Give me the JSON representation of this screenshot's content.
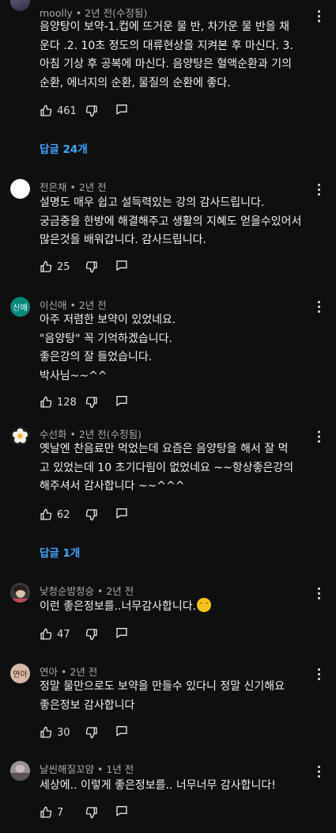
{
  "comments": [
    {
      "author": "moolly",
      "time": "2년 전(수정됨)",
      "lines": [
        "음양탕이 보약-1.컵에 뜨거운 물 반, 차가운 물 반을 채",
        "운다 .2. 10초 정도의 대류현상을 지켜본 후 마신다. 3.",
        "아침 기상 후 공복에 마신다. 음양탕은 혈액순환과 기의",
        "순환, 에너지의 순환, 물질의 순환에 좋다."
      ],
      "likes": "461",
      "replies": "답글 24개",
      "avatar_text": ""
    },
    {
      "author": "전은채",
      "time": "2년 전",
      "lines": [
        "설명도 매우 쉽고 설득력있는 강의 감사드립니다.",
        "궁금중을 한방에 해결해주고 생활의 지혜도 얻을수있어서",
        "많은것을 배워갑니다. 감사드립니다."
      ],
      "likes": "25",
      "avatar_text": ""
    },
    {
      "author": "이신애",
      "time": "2년 전",
      "lines": [
        "아주 저렴한 보약이 있었네요.",
        "\"음양탕\" 꼭 기억하겠습니다.",
        "좋은강의 잘 들었습니다.",
        "박사님~~^^"
      ],
      "likes": "128",
      "avatar_text": "신애"
    },
    {
      "author": "수선화",
      "time": "2년 전(수정됨)",
      "lines": [
        "옛날엔 찬음료만 먹었는데 요즘은 음양탕을 해서  잘 먹",
        "고 있었는데 10 초기다림이 없었네요 ~~항상좋은강의",
        "해주셔서 감사합니다 ~~^^^"
      ],
      "likes": "62",
      "replies": "답글 1개",
      "avatar_text": ""
    },
    {
      "author": "낮청순밤청승",
      "time": "2년 전",
      "lines": [
        "이런 좋은정보를..너무감사합니다."
      ],
      "likes": "47",
      "avatar_text": ""
    },
    {
      "author": "연아",
      "time": "2년 전",
      "lines": [
        "정말 물만으로도 보약을 만들수 있다니 정말 신기해요",
        "좋은정보 감사합니다"
      ],
      "likes": "30",
      "avatar_text": "연아"
    },
    {
      "author": "날씬해질꼬얌",
      "time": "1년 전",
      "lines": [
        "세상에.. 이렇게 좋은정보를.. 너무너무 감사합니다!"
      ],
      "likes": "7",
      "avatar_text": ""
    }
  ],
  "meta_separator": " • ",
  "colors": {
    "background": "#0f0f0f",
    "text": "#f1f1f1",
    "meta": "#aaaaaa",
    "link": "#3ea6ff",
    "avatar_sinae": "#00897b",
    "avatar_yeona": "#d7b9a6"
  }
}
